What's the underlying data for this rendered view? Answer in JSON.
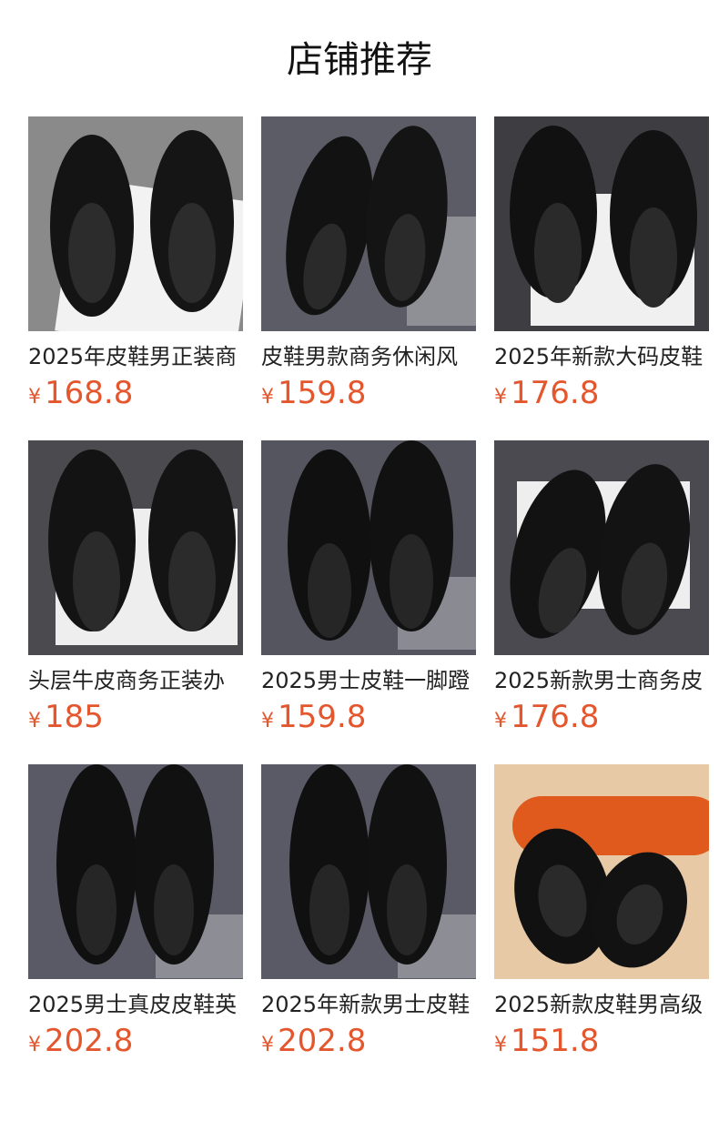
{
  "header": {
    "title": "店铺推荐"
  },
  "currency_symbol": "¥",
  "colors": {
    "price": "#e4572e"
  },
  "products": [
    {
      "name": "2025年皮鞋男正装商",
      "price": "168.8",
      "image_icon": "shoe-image-icon",
      "bg": "#8a8a8a"
    },
    {
      "name": "皮鞋男款商务休闲风",
      "price": "159.8",
      "image_icon": "shoe-image-icon",
      "bg": "#5c5c66"
    },
    {
      "name": "2025年新款大码皮鞋",
      "price": "176.8",
      "image_icon": "shoe-image-icon",
      "bg": "#3e3e42"
    },
    {
      "name": "头层牛皮商务正装办",
      "price": "185",
      "image_icon": "shoe-image-icon",
      "bg": "#4a4a4f"
    },
    {
      "name": "2025男士皮鞋一脚蹬",
      "price": "159.8",
      "image_icon": "shoe-image-icon",
      "bg": "#55555f"
    },
    {
      "name": "2025新款男士商务皮",
      "price": "176.8",
      "image_icon": "shoe-image-icon",
      "bg": "#4a4a50"
    },
    {
      "name": "2025男士真皮皮鞋英",
      "price": "202.8",
      "image_icon": "shoe-image-icon",
      "bg": "#5a5a66"
    },
    {
      "name": "2025年新款男士皮鞋",
      "price": "202.8",
      "image_icon": "shoe-image-icon",
      "bg": "#5a5a66"
    },
    {
      "name": "2025新款皮鞋男高级",
      "price": "151.8",
      "image_icon": "shoe-image-icon",
      "bg": "#e8c9a6"
    }
  ]
}
